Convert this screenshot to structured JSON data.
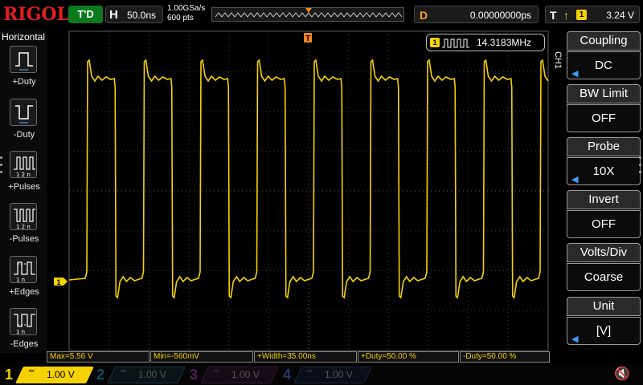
{
  "brand": "RIGOL",
  "trigger_status": "T'D",
  "horizontal": {
    "label": "H",
    "timebase": "50.0ns",
    "sample_rate": "1.00GSa/s",
    "mem_depth": "600 pts"
  },
  "delay": {
    "label": "D",
    "value": "0.00000000ps"
  },
  "trigger": {
    "label": "T",
    "edge_icon": "rising-edge-icon",
    "source": "1",
    "level": "3.24 V"
  },
  "left_menu": {
    "title": "Horizontal",
    "items": [
      {
        "label": "+Duty",
        "icon": "positive-duty-icon"
      },
      {
        "label": "-Duty",
        "icon": "negative-duty-icon"
      },
      {
        "label": "+Pulses",
        "icon": "positive-pulses-icon"
      },
      {
        "label": "-Pulses",
        "icon": "negative-pulses-icon"
      },
      {
        "label": "+Edges",
        "icon": "positive-edges-icon"
      },
      {
        "label": "-Edges",
        "icon": "negative-edges-icon"
      }
    ]
  },
  "right_menu": {
    "channel_tab": "CH1",
    "items": [
      {
        "title": "Coupling",
        "value": "DC"
      },
      {
        "title": "BW Limit",
        "value": "OFF"
      },
      {
        "title": "Probe",
        "value": "10X"
      },
      {
        "title": "Invert",
        "value": "OFF"
      },
      {
        "title": "Volts/Div",
        "value": "Coarse"
      },
      {
        "title": "Unit",
        "value": "[V]"
      }
    ]
  },
  "frequency_counter": {
    "channel": "1",
    "value": "14.3183MHz"
  },
  "markers": {
    "channel_ground": "1",
    "trigger_position": "T"
  },
  "measurements": [
    {
      "text": "Max=5.56 V"
    },
    {
      "text": "Min=-560mV"
    },
    {
      "text": "+Width=35.00ns"
    },
    {
      "text": "+Duty=50.00 %"
    },
    {
      "text": "-Duty=50.00 %"
    }
  ],
  "channels": [
    {
      "num": "1",
      "scale": "1.00 V",
      "color": "#f5d200",
      "active": true
    },
    {
      "num": "2",
      "scale": "1.00 V",
      "color": "#00a8c8",
      "active": false
    },
    {
      "num": "3",
      "scale": "1.00 V",
      "color": "#c000c0",
      "active": false
    },
    {
      "num": "4",
      "scale": "1.00 V",
      "color": "#2a70d0",
      "active": false
    }
  ],
  "colors": {
    "ch1": "#f5d200",
    "trigger": "#f5861f",
    "brand": "#e02020",
    "trig_status_bg": "#0b7a1e"
  }
}
